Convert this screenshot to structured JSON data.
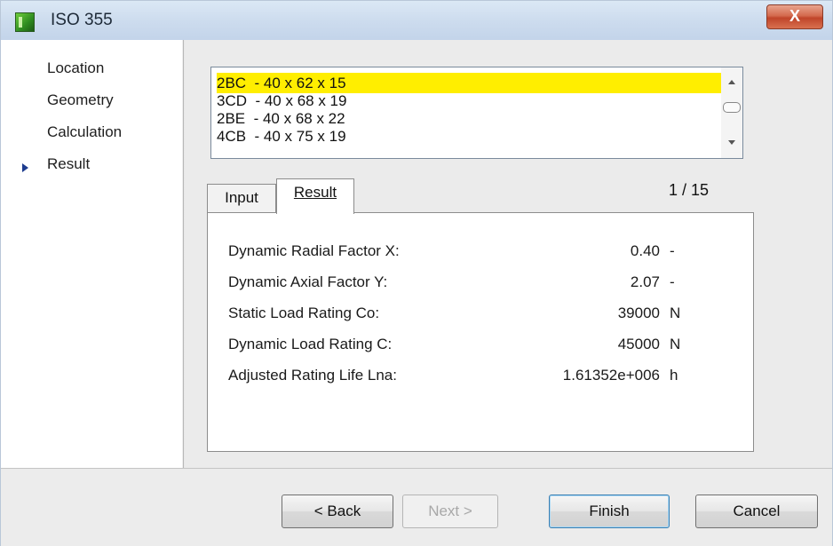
{
  "window": {
    "title": "ISO 355",
    "close_label": "X"
  },
  "nav": {
    "items": [
      "Location",
      "Geometry",
      "Calculation",
      "Result"
    ],
    "active": "Result"
  },
  "list": {
    "items": [
      "2BC  - 40 x 62 x 15",
      "3CD  - 40 x 68 x 19",
      "2BE  - 40 x 68 x 22",
      "4CB  - 40 x 75 x 19"
    ],
    "selected_index": 0,
    "highlight_color": "#ffee00"
  },
  "tabs": {
    "input_label": "Input",
    "result_label": "Result",
    "active": "Result"
  },
  "page_count": "1 / 15",
  "results": [
    {
      "label": "Dynamic Radial Factor X:",
      "value": "0.40",
      "unit": "-"
    },
    {
      "label": "Dynamic Axial Factor Y:",
      "value": "2.07",
      "unit": "-"
    },
    {
      "label": "Static Load Rating Co:",
      "value": "39000",
      "unit": "N"
    },
    {
      "label": "Dynamic Load Rating C:",
      "value": "45000",
      "unit": "N"
    },
    {
      "label": "Adjusted Rating Life Lna:",
      "value": "1.61352e+006",
      "unit": "h"
    }
  ],
  "buttons": {
    "back": "< Back",
    "next": "Next >",
    "finish": "Finish",
    "cancel": "Cancel"
  }
}
